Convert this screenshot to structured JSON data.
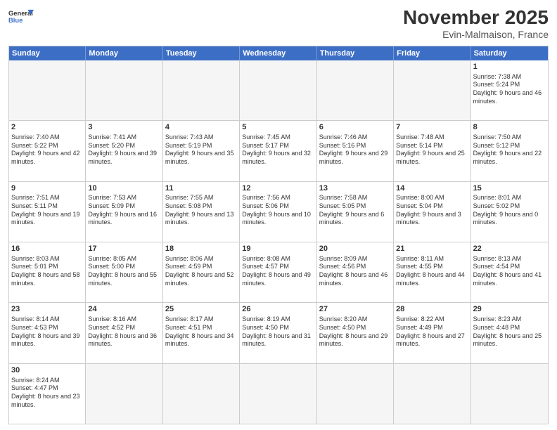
{
  "header": {
    "logo_general": "General",
    "logo_blue": "Blue",
    "month_title": "November 2025",
    "location": "Evin-Malmaison, France"
  },
  "days_of_week": [
    "Sunday",
    "Monday",
    "Tuesday",
    "Wednesday",
    "Thursday",
    "Friday",
    "Saturday"
  ],
  "weeks": [
    [
      {
        "day": "",
        "empty": true
      },
      {
        "day": "",
        "empty": true
      },
      {
        "day": "",
        "empty": true
      },
      {
        "day": "",
        "empty": true
      },
      {
        "day": "",
        "empty": true
      },
      {
        "day": "",
        "empty": true
      },
      {
        "day": "1",
        "sunrise": "7:38 AM",
        "sunset": "5:24 PM",
        "daylight": "9 hours and 46 minutes."
      }
    ],
    [
      {
        "day": "2",
        "sunrise": "7:40 AM",
        "sunset": "5:22 PM",
        "daylight": "9 hours and 42 minutes."
      },
      {
        "day": "3",
        "sunrise": "7:41 AM",
        "sunset": "5:20 PM",
        "daylight": "9 hours and 39 minutes."
      },
      {
        "day": "4",
        "sunrise": "7:43 AM",
        "sunset": "5:19 PM",
        "daylight": "9 hours and 35 minutes."
      },
      {
        "day": "5",
        "sunrise": "7:45 AM",
        "sunset": "5:17 PM",
        "daylight": "9 hours and 32 minutes."
      },
      {
        "day": "6",
        "sunrise": "7:46 AM",
        "sunset": "5:16 PM",
        "daylight": "9 hours and 29 minutes."
      },
      {
        "day": "7",
        "sunrise": "7:48 AM",
        "sunset": "5:14 PM",
        "daylight": "9 hours and 25 minutes."
      },
      {
        "day": "8",
        "sunrise": "7:50 AM",
        "sunset": "5:12 PM",
        "daylight": "9 hours and 22 minutes."
      }
    ],
    [
      {
        "day": "9",
        "sunrise": "7:51 AM",
        "sunset": "5:11 PM",
        "daylight": "9 hours and 19 minutes."
      },
      {
        "day": "10",
        "sunrise": "7:53 AM",
        "sunset": "5:09 PM",
        "daylight": "9 hours and 16 minutes."
      },
      {
        "day": "11",
        "sunrise": "7:55 AM",
        "sunset": "5:08 PM",
        "daylight": "9 hours and 13 minutes."
      },
      {
        "day": "12",
        "sunrise": "7:56 AM",
        "sunset": "5:06 PM",
        "daylight": "9 hours and 10 minutes."
      },
      {
        "day": "13",
        "sunrise": "7:58 AM",
        "sunset": "5:05 PM",
        "daylight": "9 hours and 6 minutes."
      },
      {
        "day": "14",
        "sunrise": "8:00 AM",
        "sunset": "5:04 PM",
        "daylight": "9 hours and 3 minutes."
      },
      {
        "day": "15",
        "sunrise": "8:01 AM",
        "sunset": "5:02 PM",
        "daylight": "9 hours and 0 minutes."
      }
    ],
    [
      {
        "day": "16",
        "sunrise": "8:03 AM",
        "sunset": "5:01 PM",
        "daylight": "8 hours and 58 minutes."
      },
      {
        "day": "17",
        "sunrise": "8:05 AM",
        "sunset": "5:00 PM",
        "daylight": "8 hours and 55 minutes."
      },
      {
        "day": "18",
        "sunrise": "8:06 AM",
        "sunset": "4:59 PM",
        "daylight": "8 hours and 52 minutes."
      },
      {
        "day": "19",
        "sunrise": "8:08 AM",
        "sunset": "4:57 PM",
        "daylight": "8 hours and 49 minutes."
      },
      {
        "day": "20",
        "sunrise": "8:09 AM",
        "sunset": "4:56 PM",
        "daylight": "8 hours and 46 minutes."
      },
      {
        "day": "21",
        "sunrise": "8:11 AM",
        "sunset": "4:55 PM",
        "daylight": "8 hours and 44 minutes."
      },
      {
        "day": "22",
        "sunrise": "8:13 AM",
        "sunset": "4:54 PM",
        "daylight": "8 hours and 41 minutes."
      }
    ],
    [
      {
        "day": "23",
        "sunrise": "8:14 AM",
        "sunset": "4:53 PM",
        "daylight": "8 hours and 39 minutes."
      },
      {
        "day": "24",
        "sunrise": "8:16 AM",
        "sunset": "4:52 PM",
        "daylight": "8 hours and 36 minutes."
      },
      {
        "day": "25",
        "sunrise": "8:17 AM",
        "sunset": "4:51 PM",
        "daylight": "8 hours and 34 minutes."
      },
      {
        "day": "26",
        "sunrise": "8:19 AM",
        "sunset": "4:50 PM",
        "daylight": "8 hours and 31 minutes."
      },
      {
        "day": "27",
        "sunrise": "8:20 AM",
        "sunset": "4:50 PM",
        "daylight": "8 hours and 29 minutes."
      },
      {
        "day": "28",
        "sunrise": "8:22 AM",
        "sunset": "4:49 PM",
        "daylight": "8 hours and 27 minutes."
      },
      {
        "day": "29",
        "sunrise": "8:23 AM",
        "sunset": "4:48 PM",
        "daylight": "8 hours and 25 minutes."
      }
    ],
    [
      {
        "day": "30",
        "sunrise": "8:24 AM",
        "sunset": "4:47 PM",
        "daylight": "8 hours and 23 minutes."
      },
      {
        "day": "",
        "empty": true
      },
      {
        "day": "",
        "empty": true
      },
      {
        "day": "",
        "empty": true
      },
      {
        "day": "",
        "empty": true
      },
      {
        "day": "",
        "empty": true
      },
      {
        "day": "",
        "empty": true
      }
    ]
  ]
}
